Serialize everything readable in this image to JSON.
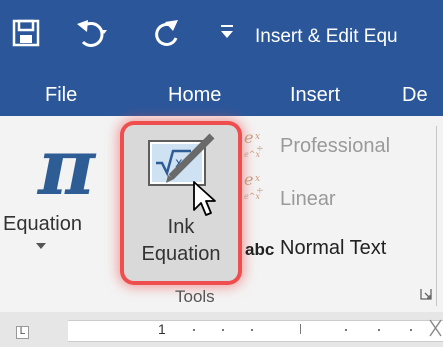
{
  "title_bar": {
    "title": "Insert & Edit Equ",
    "icons": [
      "save-icon",
      "undo-icon",
      "redo-icon",
      "customize-qat-icon"
    ]
  },
  "tabs": [
    {
      "label": "File"
    },
    {
      "label": "Home"
    },
    {
      "label": "Insert"
    },
    {
      "label": "De"
    }
  ],
  "ribbon": {
    "equation": {
      "label": "Equation",
      "icon": "pi-icon"
    },
    "ink_equation": {
      "label_line1": "Ink",
      "label_line2": "Equation",
      "icon": "ink-equation-icon",
      "highlighted": true
    },
    "conversions": [
      {
        "label": "Professional",
        "icon": "professional-format-icon",
        "enabled": false
      },
      {
        "label": "Linear",
        "icon": "linear-format-icon",
        "enabled": false
      },
      {
        "label": "Normal Text",
        "icon_text": "abc",
        "enabled": true
      }
    ],
    "group_label": "Tools"
  },
  "ruler": {
    "corner_label": "L",
    "number": "1"
  },
  "colors": {
    "title_bar": "#2b579a",
    "pi": "#2e5d95",
    "highlight": "#ef4e4e",
    "ribbon": "#f3f3f3"
  }
}
